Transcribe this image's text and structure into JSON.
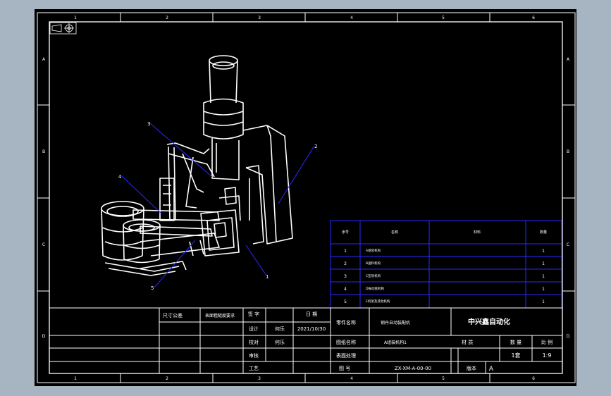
{
  "colors": {
    "background": "#a7b4c2",
    "sheet": "#000000",
    "lines": "#ffffff",
    "bom_lines": "#2a2aff",
    "leader_lines": "#2a2aff",
    "drawing": "#ffffff"
  },
  "zones": {
    "top": [
      "1",
      "2",
      "3",
      "4",
      "5",
      "6"
    ],
    "bottom": [
      "1",
      "2",
      "3",
      "4",
      "5",
      "6"
    ],
    "side": [
      "A",
      "B",
      "C",
      "D"
    ]
  },
  "callouts": [
    "1",
    "2",
    "3",
    "4",
    "5"
  ],
  "bom": {
    "headers": [
      "序号",
      "名称",
      "材料",
      "数量"
    ],
    "rows": [
      {
        "no": "1",
        "name": "A组装机构",
        "material": "",
        "qty": "1"
      },
      {
        "no": "2",
        "name": "B送料机构",
        "material": "",
        "qty": "1"
      },
      {
        "no": "3",
        "name": "C压装机构",
        "material": "",
        "qty": "1"
      },
      {
        "no": "4",
        "name": "D振动盘机构",
        "material": "",
        "qty": "1"
      },
      {
        "no": "5",
        "name": "E机架及其他机构",
        "material": "",
        "qty": "1"
      }
    ]
  },
  "title_block": {
    "tol_label": "尺寸公差",
    "surface_label": "表面粗糙度要求",
    "sign_label": "签 字",
    "date_label": "日 期",
    "design_label": "设计",
    "designer": "何乐",
    "date": "2021/10/30",
    "check_label": "校对",
    "checker": "何乐",
    "review_label": "审核",
    "approve_label": "工艺",
    "part_label": "零件名称",
    "part_value": "钢丹自动装配机",
    "drawing_label": "图纸名称",
    "drawing_value": "A组装机构1",
    "surface_treat_label": "表面处理",
    "company": "中兴鑫自动化",
    "material_label": "材 质",
    "qty_label": "数 量",
    "scale_label": "比 例",
    "qty_value": "1套",
    "scale_value": "1:9",
    "drawing_no_label": "图 号",
    "drawing_no": "ZX-XM-A-00-00",
    "version_label": "版本",
    "version": "A"
  }
}
